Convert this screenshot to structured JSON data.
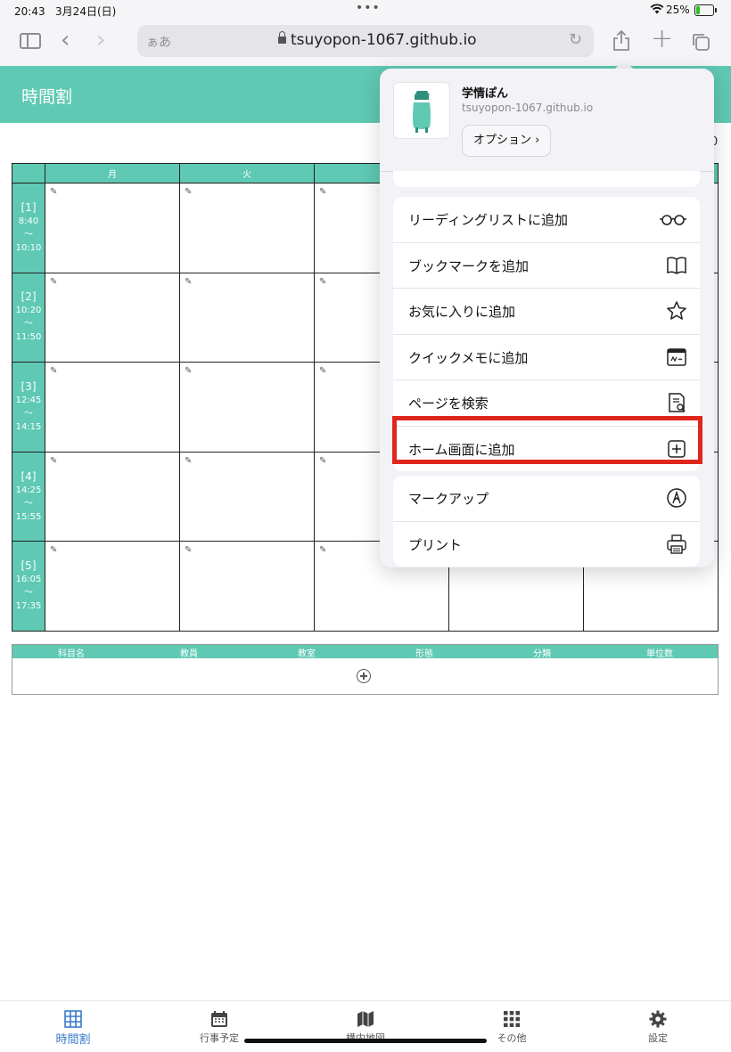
{
  "status_bar": {
    "time": "20:43",
    "date": "3月24日(日)",
    "battery_pct": "25%",
    "battery_level": 0.25
  },
  "browser": {
    "aa_label": "ぁあ",
    "url": "tsuyopon-1067.github.io"
  },
  "app": {
    "header_title": "時間割",
    "right_fragment": "0",
    "days": [
      "月",
      "火"
    ],
    "periods": [
      {
        "num": "[1]",
        "start": "8:40",
        "sep": "〜",
        "end": "10:10"
      },
      {
        "num": "[2]",
        "start": "10:20",
        "sep": "〜",
        "end": "11:50"
      },
      {
        "num": "[3]",
        "start": "12:45",
        "sep": "〜",
        "end": "14:15"
      },
      {
        "num": "[4]",
        "start": "14:25",
        "sep": "〜",
        "end": "15:55"
      },
      {
        "num": "[5]",
        "start": "16:05",
        "sep": "〜",
        "end": "17:35"
      }
    ],
    "subject_columns": [
      "科目名",
      "教員",
      "教室",
      "形態",
      "分類",
      "単位数"
    ]
  },
  "share_sheet": {
    "app_name": "学情ぽん",
    "app_url": "tsuyopon-1067.github.io",
    "options_label": "オプション",
    "group1": [
      {
        "label": "リーディングリストに追加",
        "icon": "glasses-icon"
      },
      {
        "label": "ブックマークを追加",
        "icon": "book-icon"
      },
      {
        "label": "お気に入りに追加",
        "icon": "star-icon"
      },
      {
        "label": "クイックメモに追加",
        "icon": "quick-note-icon"
      },
      {
        "label": "ページを検索",
        "icon": "find-in-page-icon"
      },
      {
        "label": "ホーム画面に追加",
        "icon": "add-square-icon"
      }
    ],
    "group2": [
      {
        "label": "マークアップ",
        "icon": "markup-icon"
      },
      {
        "label": "プリント",
        "icon": "printer-icon"
      }
    ]
  },
  "tabbar": [
    {
      "label": "時間割",
      "icon": "grid-icon",
      "active": true
    },
    {
      "label": "行事予定",
      "icon": "calendar-icon"
    },
    {
      "label": "構内地図",
      "icon": "map-icon"
    },
    {
      "label": "その他",
      "icon": "dots-grid-icon"
    },
    {
      "label": "設定",
      "icon": "gear-icon"
    }
  ],
  "colors": {
    "accent": "#5fc9b3",
    "highlight": "#e0261d",
    "tab_active": "#3a7ac8"
  }
}
